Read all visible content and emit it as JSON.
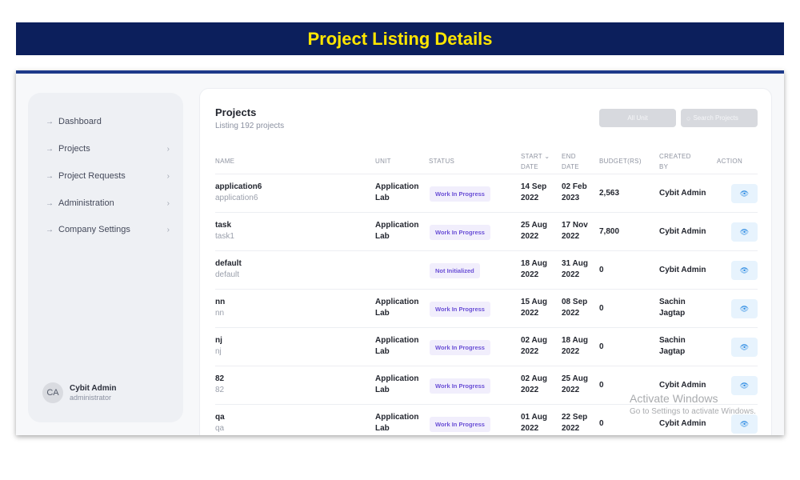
{
  "banner": {
    "title": "Project Listing Details"
  },
  "sidebar": {
    "items": [
      {
        "label": "Dashboard",
        "arrow": "→",
        "chevron": ""
      },
      {
        "label": "Projects",
        "arrow": "→",
        "chevron": "›"
      },
      {
        "label": "Project Requests",
        "arrow": "→",
        "chevron": "›"
      },
      {
        "label": "Administration",
        "arrow": "→",
        "chevron": "›"
      },
      {
        "label": "Company Settings",
        "arrow": "→",
        "chevron": "›"
      }
    ],
    "user": {
      "initials": "CA",
      "name": "Cybit Admin",
      "role": "administrator"
    }
  },
  "main": {
    "title": "Projects",
    "subtitle": "Listing 192 projects",
    "filter_label": "All Unit",
    "search_placeholder": "Search Projects",
    "search_icon": "search-icon"
  },
  "table": {
    "headers": {
      "name": "NAME",
      "unit": "UNIT",
      "status": "STATUS",
      "start_line1": "START",
      "start_line2": "DATE",
      "sort_icon": "⌄",
      "end_line1": "END",
      "end_line2": "DATE",
      "budget": "BUDGET(RS)",
      "created_line1": "CREATED",
      "created_line2": "BY",
      "action": "ACTION"
    },
    "view_icon": "👁",
    "rows": [
      {
        "name": "application6",
        "code": "application6",
        "unit1": "Application",
        "unit2": "Lab",
        "status": "Work In Progress",
        "start1": "14 Sep",
        "start2": "2022",
        "end1": "02 Feb",
        "end2": "2023",
        "budget": "2,563",
        "by1": "Cybit Admin",
        "by2": ""
      },
      {
        "name": "task",
        "code": "task1",
        "unit1": "Application",
        "unit2": "Lab",
        "status": "Work In Progress",
        "start1": "25 Aug",
        "start2": "2022",
        "end1": "17 Nov",
        "end2": "2022",
        "budget": "7,800",
        "by1": "Cybit Admin",
        "by2": ""
      },
      {
        "name": "default",
        "code": "default",
        "unit1": "",
        "unit2": "",
        "status": "Not Initialized",
        "start1": "18 Aug",
        "start2": "2022",
        "end1": "31 Aug",
        "end2": "2022",
        "budget": "0",
        "by1": "Cybit Admin",
        "by2": ""
      },
      {
        "name": "nn",
        "code": "nn",
        "unit1": "Application",
        "unit2": "Lab",
        "status": "Work In Progress",
        "start1": "15 Aug",
        "start2": "2022",
        "end1": "08 Sep",
        "end2": "2022",
        "budget": "0",
        "by1": "Sachin",
        "by2": "Jagtap"
      },
      {
        "name": "nj",
        "code": "nj",
        "unit1": "Application",
        "unit2": "Lab",
        "status": "Work In Progress",
        "start1": "02 Aug",
        "start2": "2022",
        "end1": "18 Aug",
        "end2": "2022",
        "budget": "0",
        "by1": "Sachin",
        "by2": "Jagtap"
      },
      {
        "name": "82",
        "code": "82",
        "unit1": "Application",
        "unit2": "Lab",
        "status": "Work In Progress",
        "start1": "02 Aug",
        "start2": "2022",
        "end1": "25 Aug",
        "end2": "2022",
        "budget": "0",
        "by1": "Cybit Admin",
        "by2": ""
      },
      {
        "name": "qa",
        "code": "qa",
        "unit1": "Application",
        "unit2": "Lab",
        "status": "Work In Progress",
        "start1": "01 Aug",
        "start2": "2022",
        "end1": "22 Sep",
        "end2": "2022",
        "budget": "0",
        "by1": "Cybit Admin",
        "by2": ""
      }
    ]
  },
  "watermark": {
    "line1": "Activate Windows",
    "line2": "Go to Settings to activate Windows."
  }
}
